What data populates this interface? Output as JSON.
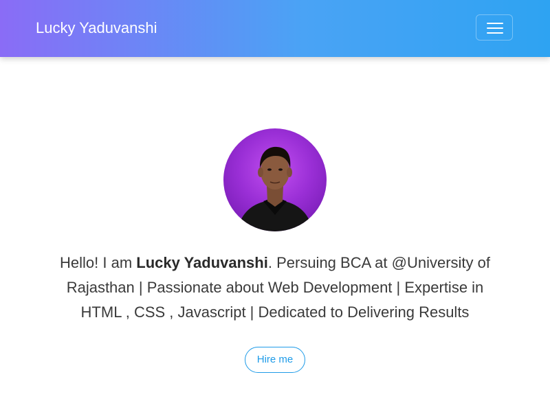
{
  "navbar": {
    "brand": "Lucky Yaduvanshi",
    "menu_icon": "hamburger-menu-icon",
    "colors": {
      "gradient_start": "#8a6cf6",
      "gradient_end": "#2ea3f2"
    }
  },
  "hero": {
    "avatar_alt": "profile-photo",
    "intro": {
      "prefix": "Hello! I am ",
      "name": "Lucky Yaduvanshi",
      "suffix": ". Persuing BCA at @University of Rajasthan | Passionate about Web Development | Expertise in HTML , CSS , Javascript | Dedicated to Delivering Results"
    },
    "hire_button": "Hire me",
    "colors": {
      "accent": "#1e9be8"
    }
  }
}
